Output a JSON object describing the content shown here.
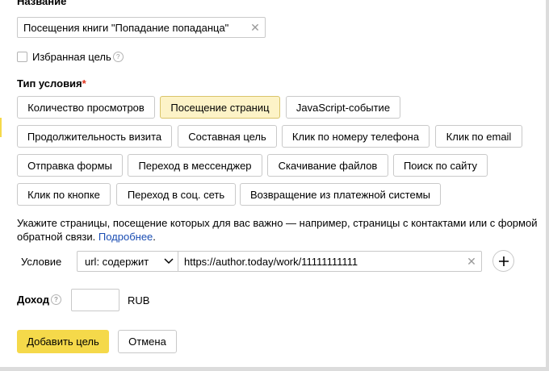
{
  "form": {
    "name_label": "Название",
    "name_value": "Посещения книги \"Попадание попаданца\"",
    "clear_symbol": "✕",
    "favorite_label": "Избранная цель",
    "help_symbol": "?",
    "condition_type_title": "Тип условия",
    "required_mark": "*"
  },
  "condition_types": [
    "Количество просмотров",
    "Посещение страниц",
    "JavaScript-событие",
    "Продолжительность визита",
    "Составная цель",
    "Клик по номеру телефона",
    "Клик по email",
    "Отправка формы",
    "Переход в мессенджер",
    "Скачивание файлов",
    "Поиск по сайту",
    "Клик по кнопке",
    "Переход в соц. сеть",
    "Возвращение из платежной системы"
  ],
  "selected_condition_type": "Посещение страниц",
  "hint": {
    "text": "Укажите страницы, посещение которых для вас важно — например, страницы с контактами или с формой обратной связи.",
    "link": "Подробнее",
    "after_link": "."
  },
  "condition": {
    "label": "Условие",
    "select_value": "url: содержит",
    "url_value": "https://author.today/work/11111111111"
  },
  "income": {
    "label": "Доход",
    "value": "",
    "currency": "RUB"
  },
  "actions": {
    "add_label": "Добавить цель",
    "cancel_label": "Отмена"
  }
}
